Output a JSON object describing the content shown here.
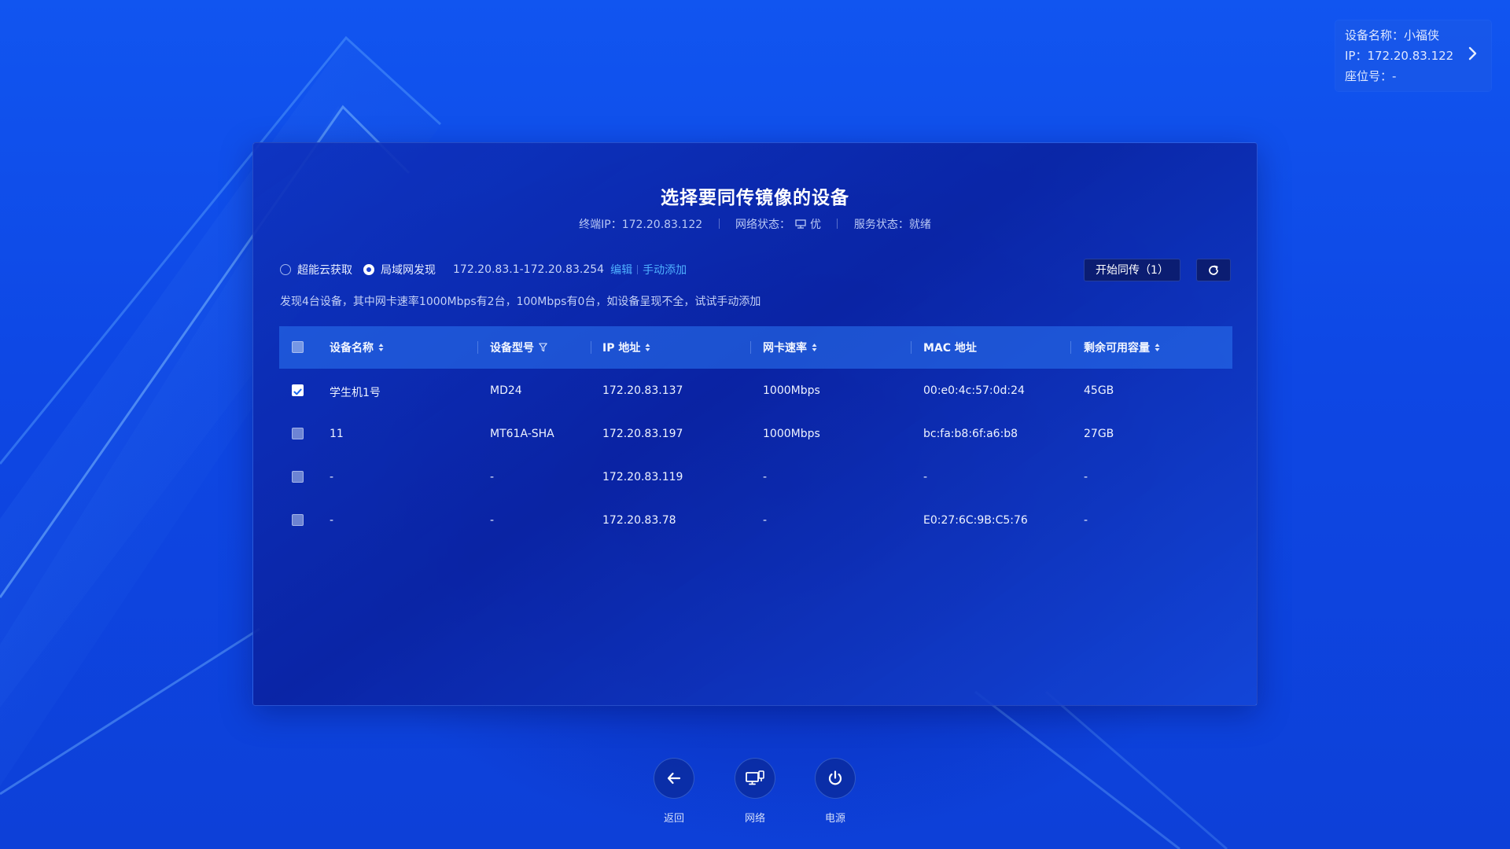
{
  "device_info": {
    "name_line": "设备名称：小福侠",
    "ip_line": "IP：172.20.83.122",
    "seat_line": "座位号：-"
  },
  "panel": {
    "title": "选择要同传镜像的设备",
    "status": {
      "terminal_ip": "终端IP：172.20.83.122",
      "network_prefix": "网络状态：",
      "network_value": "优",
      "service": "服务状态：就绪"
    },
    "modes": {
      "cloud": "超能云获取",
      "lan": "局域网发现",
      "selected": "lan"
    },
    "ip_range": "172.20.83.1-172.20.83.254",
    "edit_link": "编辑",
    "manual_add_link": "手动添加",
    "start_button": "开始同传（1）",
    "hint": "发现4台设备，其中网卡速率1000Mbps有2台，100Mbps有0台，如设备呈现不全，试试手动添加",
    "table": {
      "headers": [
        "设备名称",
        "设备型号",
        "IP 地址",
        "网卡速率",
        "MAC 地址",
        "剩余可用容量"
      ],
      "rows": [
        {
          "checked": true,
          "name": "学生机1号",
          "model": "MD24",
          "ip": "172.20.83.137",
          "speed": "1000Mbps",
          "mac": "00:e0:4c:57:0d:24",
          "capacity": "45GB"
        },
        {
          "checked": false,
          "name": "11",
          "model": "MT61A-SHA",
          "ip": "172.20.83.197",
          "speed": "1000Mbps",
          "mac": "bc:fa:b8:6f:a6:b8",
          "capacity": "27GB"
        },
        {
          "checked": false,
          "name": "-",
          "model": "-",
          "ip": "172.20.83.119",
          "speed": "-",
          "mac": "-",
          "capacity": "-"
        },
        {
          "checked": false,
          "name": "-",
          "model": "-",
          "ip": "172.20.83.78",
          "speed": "-",
          "mac": "E0:27:6C:9B:C5:76",
          "capacity": "-"
        }
      ]
    }
  },
  "dock": {
    "back": "返回",
    "network": "网络",
    "power": "电源"
  },
  "colors": {
    "background": "#0e47e4",
    "panel": "#0c2aa8",
    "accent_link": "#4fb0ff",
    "button": "#0b1d72"
  },
  "icons": {
    "chevron": "chevron-right-icon",
    "refresh": "refresh-icon",
    "back": "arrow-left-icon",
    "network": "monitor-network-icon",
    "power": "power-icon"
  }
}
